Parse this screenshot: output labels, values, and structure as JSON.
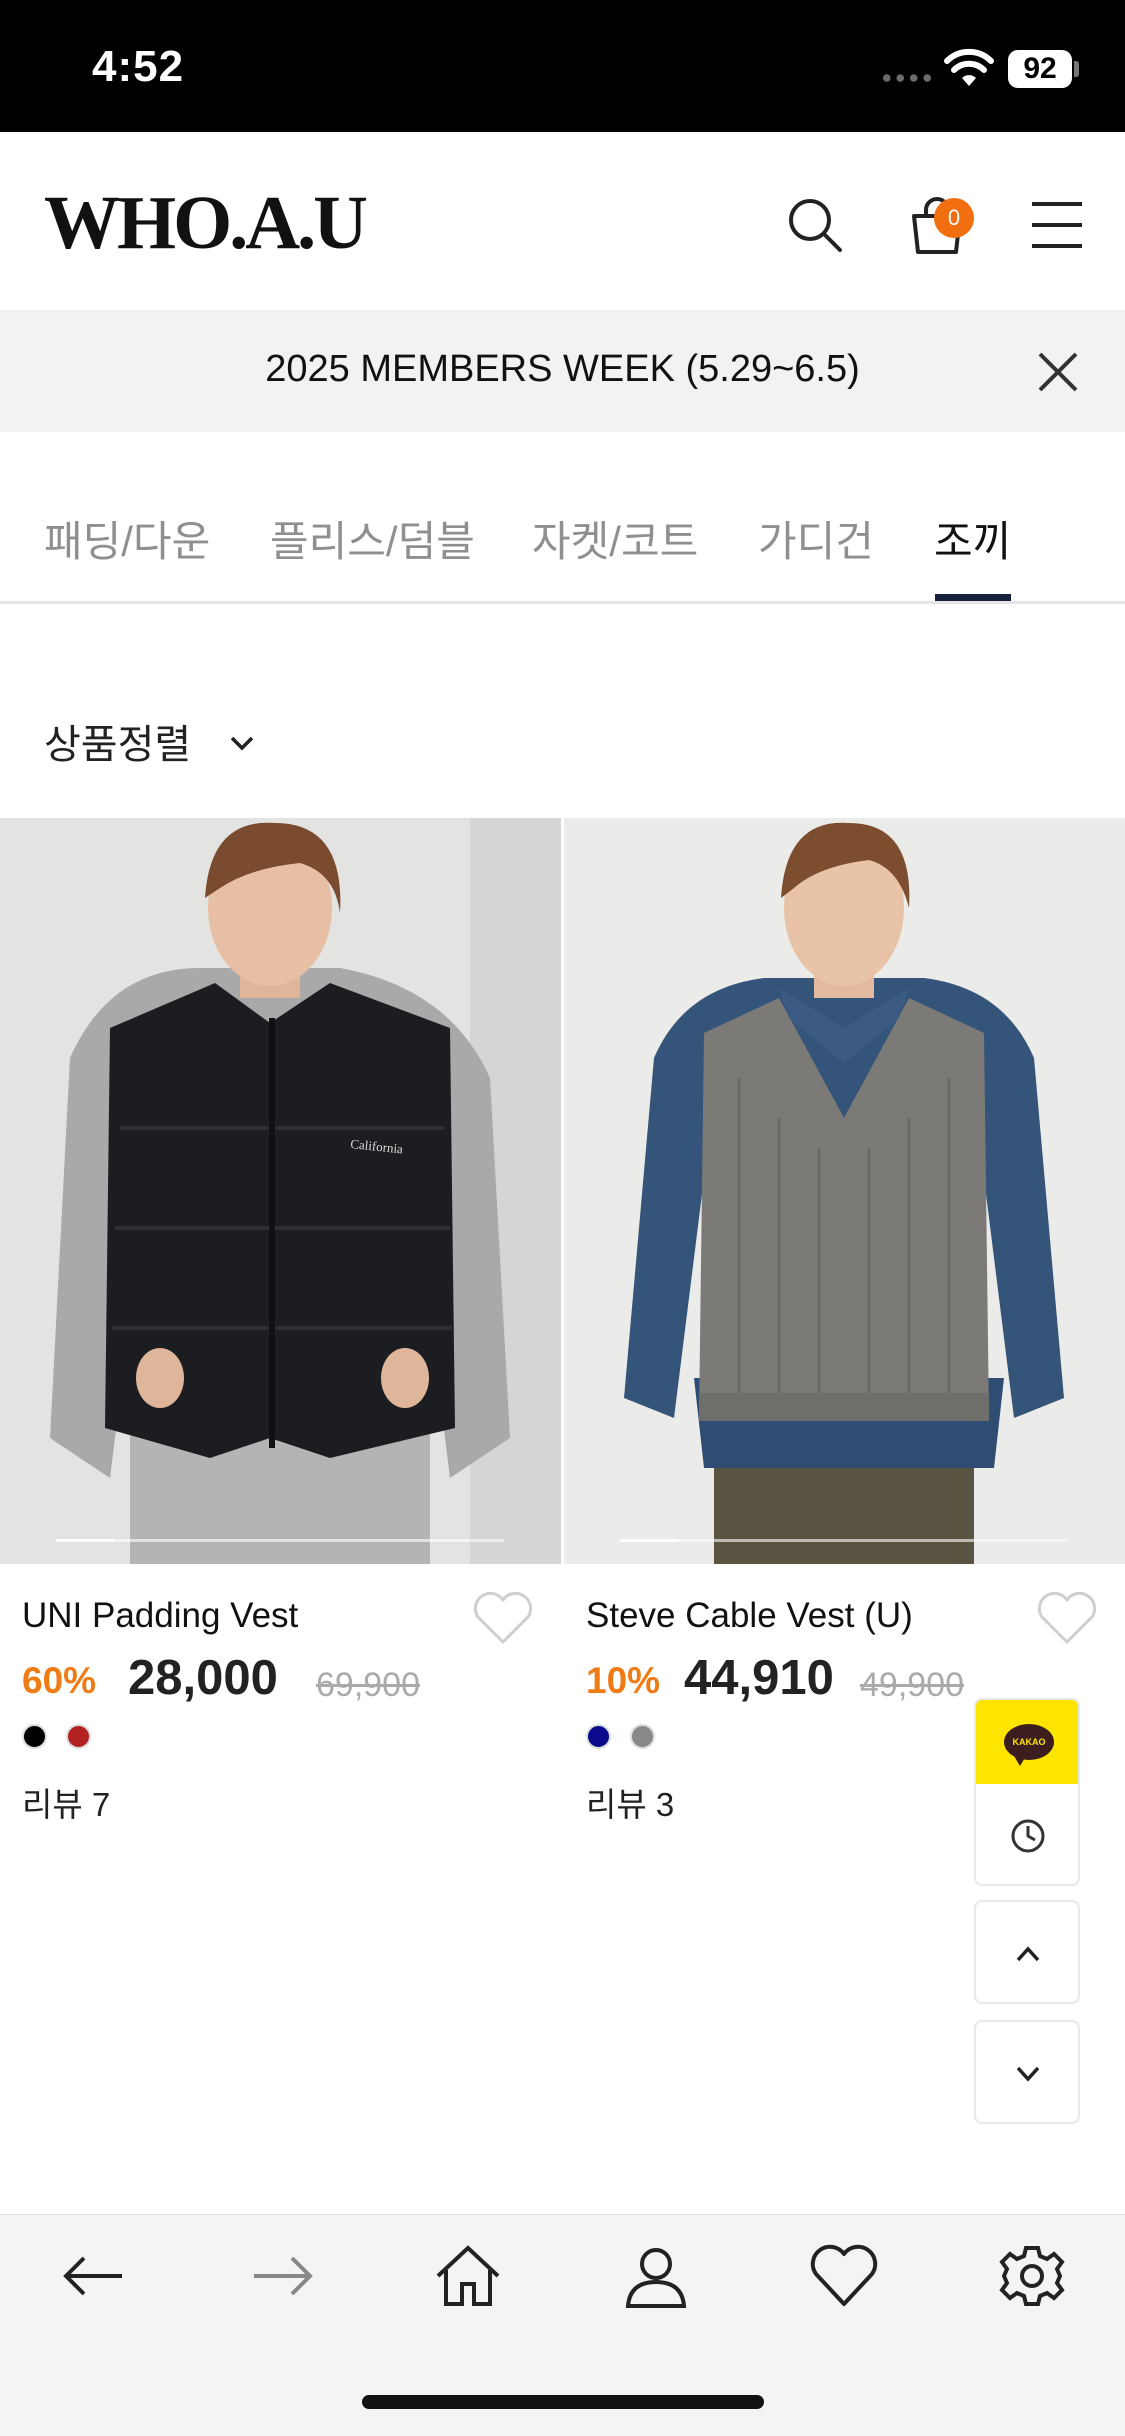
{
  "status_bar": {
    "time": "4:52",
    "battery": "92"
  },
  "header": {
    "logo": "WHO.A.U",
    "cart_count": "0"
  },
  "banner": {
    "text": "2025 MEMBERS WEEK (5.29~6.5)"
  },
  "tabs": [
    {
      "label": "패딩/다운"
    },
    {
      "label": "플리스/덤블"
    },
    {
      "label": "자켓/코트"
    },
    {
      "label": "가디건"
    },
    {
      "label": "조끼",
      "active": true
    }
  ],
  "sort": {
    "label": "상품정렬"
  },
  "products": [
    {
      "name": "UNI Padding Vest",
      "discount": "60%",
      "price": "28,000",
      "original_price": "69,900",
      "colors": [
        "#000000",
        "#b22222"
      ],
      "reviews": "리뷰 7",
      "image_progress": 0.13
    },
    {
      "name": "Steve Cable Vest (U)",
      "discount": "10%",
      "price": "44,910",
      "original_price": "49,900",
      "colors": [
        "#0a0a8c",
        "#888888"
      ],
      "reviews": "리뷰 3",
      "image_progress": 0.13
    }
  ],
  "floating": {
    "kakao_label": "KAKAO"
  },
  "colors": {
    "accent_orange": "#ef7b14",
    "tab_underline": "#16213e",
    "kakao_yellow": "#fee500"
  }
}
